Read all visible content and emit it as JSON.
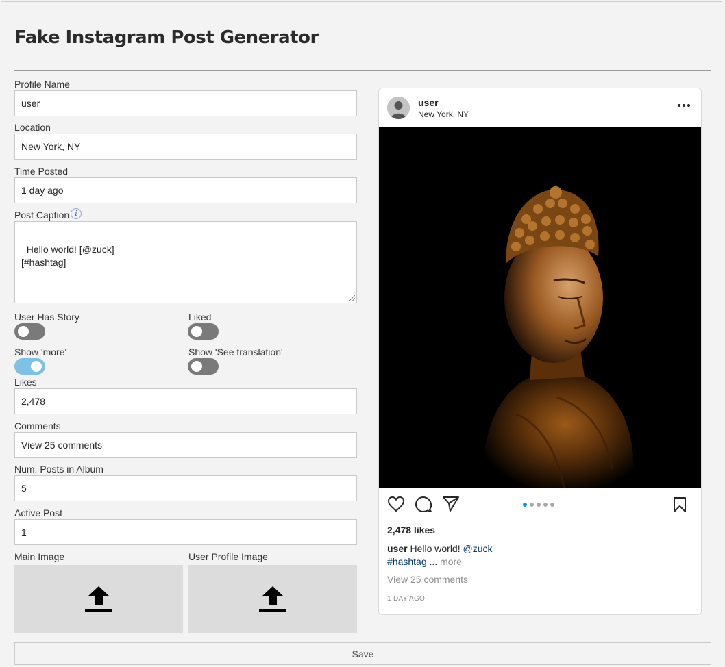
{
  "page": {
    "title": "Fake Instagram Post Generator"
  },
  "form": {
    "profile_name": {
      "label": "Profile Name",
      "value": "user"
    },
    "location": {
      "label": "Location",
      "value": "New York, NY"
    },
    "time_posted": {
      "label": "Time Posted",
      "value": "1 day ago"
    },
    "post_caption": {
      "label": "Post Caption",
      "value": "Hello world! [@zuck]\n[#hashtag]",
      "info_icon": "info-icon"
    },
    "toggles": {
      "user_has_story": {
        "label": "User Has Story",
        "on": false
      },
      "liked": {
        "label": "Liked",
        "on": false
      },
      "show_more": {
        "label": "Show 'more'",
        "on": true
      },
      "show_translation": {
        "label": "Show 'See translation'",
        "on": false
      }
    },
    "likes": {
      "label": "Likes",
      "value": "2,478"
    },
    "comments": {
      "label": "Comments",
      "value": "View 25 comments"
    },
    "num_posts": {
      "label": "Num. Posts in Album",
      "value": "5"
    },
    "active_post": {
      "label": "Active Post",
      "value": "1"
    },
    "main_image": {
      "label": "Main Image",
      "icon": "upload-icon"
    },
    "profile_image": {
      "label": "User Profile Image",
      "icon": "upload-icon"
    },
    "save_label": "Save"
  },
  "post": {
    "username": "user",
    "location": "New York, NY",
    "likes_text": "2,478 likes",
    "caption_user": "user",
    "caption_text": "Hello world!",
    "caption_mention": "@zuck",
    "caption_hashtag": "#hashtag",
    "caption_ellipsis": "...",
    "caption_more": "more",
    "comments_text": "View 25 comments",
    "time_text": "1 DAY AGO",
    "album_count": 5,
    "active_index": 1
  },
  "colors": {
    "accent": "#0095f6",
    "toggle_on": "#7fc0e6",
    "toggle_off": "#7a7a7a"
  }
}
